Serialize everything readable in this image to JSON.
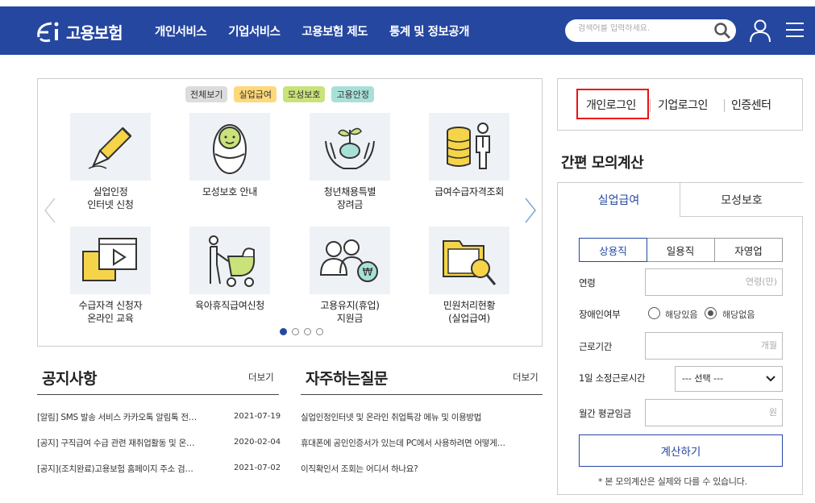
{
  "header": {
    "logo_text": "고용보험",
    "nav": [
      "개인서비스",
      "기업서비스",
      "고용보험 제도",
      "통계 및 정보공개"
    ],
    "search_placeholder": "검색어를 입력하세요.",
    "bg_color": "#2547a0"
  },
  "slider": {
    "categories": [
      {
        "label": "전체보기",
        "color": "#dcdcdc"
      },
      {
        "label": "실업급여",
        "color": "#ffd87a"
      },
      {
        "label": "모성보호",
        "color": "#c9e27a"
      },
      {
        "label": "고용안정",
        "color": "#a8e0d8"
      }
    ],
    "items": [
      {
        "line1": "실업인정",
        "line2": "인터넷 신청",
        "icon": "pencil-icon"
      },
      {
        "line1": "모성보호 안내",
        "line2": "",
        "icon": "baby-icon"
      },
      {
        "line1": "청년채용특별",
        "line2": "장려금",
        "icon": "sprout-hands-icon"
      },
      {
        "line1": "급여수급자격조회",
        "line2": "",
        "icon": "coins-person-icon"
      },
      {
        "line1": "수급자격 신청자",
        "line2": "온라인 교육",
        "icon": "video-play-icon"
      },
      {
        "line1": "육아휴직급여신청",
        "line2": "",
        "icon": "stroller-icon"
      },
      {
        "line1": "고용유지(휴업)",
        "line2": "지원금",
        "icon": "people-won-icon"
      },
      {
        "line1": "민원처리현황",
        "line2": "(실업급여)",
        "icon": "folder-search-icon"
      }
    ],
    "pages": 4,
    "active_page": 1
  },
  "notice": {
    "title": "공지사항",
    "more": "더보기",
    "rows": [
      {
        "text": "[알림] SMS 발송 서비스 카카오톡 알림톡 전…",
        "date": "2021-07-19"
      },
      {
        "text": "[공지] 구직급여 수급 관련 재취업활동 및 온…",
        "date": "2020-02-04"
      },
      {
        "text": "[공지](조치완료)고용보험 홈페이지 주소 검…",
        "date": "2021-07-02"
      }
    ]
  },
  "faq": {
    "title": "자주하는질문",
    "more": "더보기",
    "rows": [
      "실업인정인터넷 및 온라인 취업특강 메뉴 및 이용방법",
      "휴대폰에 공인인증서가 있는데 PC에서 사용하려면 어떻게…",
      "이직확인서 조회는 어디서 하나요?"
    ]
  },
  "login": {
    "personal": "개인로그인",
    "business": "기업로그인",
    "cert": "인증센터"
  },
  "calc": {
    "title": "간편 모의계산",
    "tabs": [
      "실업급여",
      "모성보호"
    ],
    "subtabs": [
      "상용직",
      "일용직",
      "자영업"
    ],
    "fields": {
      "age_label": "연령",
      "age_placeholder": "연령(만)",
      "disabled_label": "장애인여부",
      "disabled_yes": "해당있음",
      "disabled_no": "해당없음",
      "period_label": "근로기간",
      "period_placeholder": "개월",
      "hours_label": "1일 소정근로시간",
      "hours_select": "--- 선택 ---",
      "wage_label": "월간 평균임금",
      "wage_placeholder": "원"
    },
    "button": "계산하기",
    "note": "* 본 모의계산은 실제와 다를 수 있습니다."
  }
}
